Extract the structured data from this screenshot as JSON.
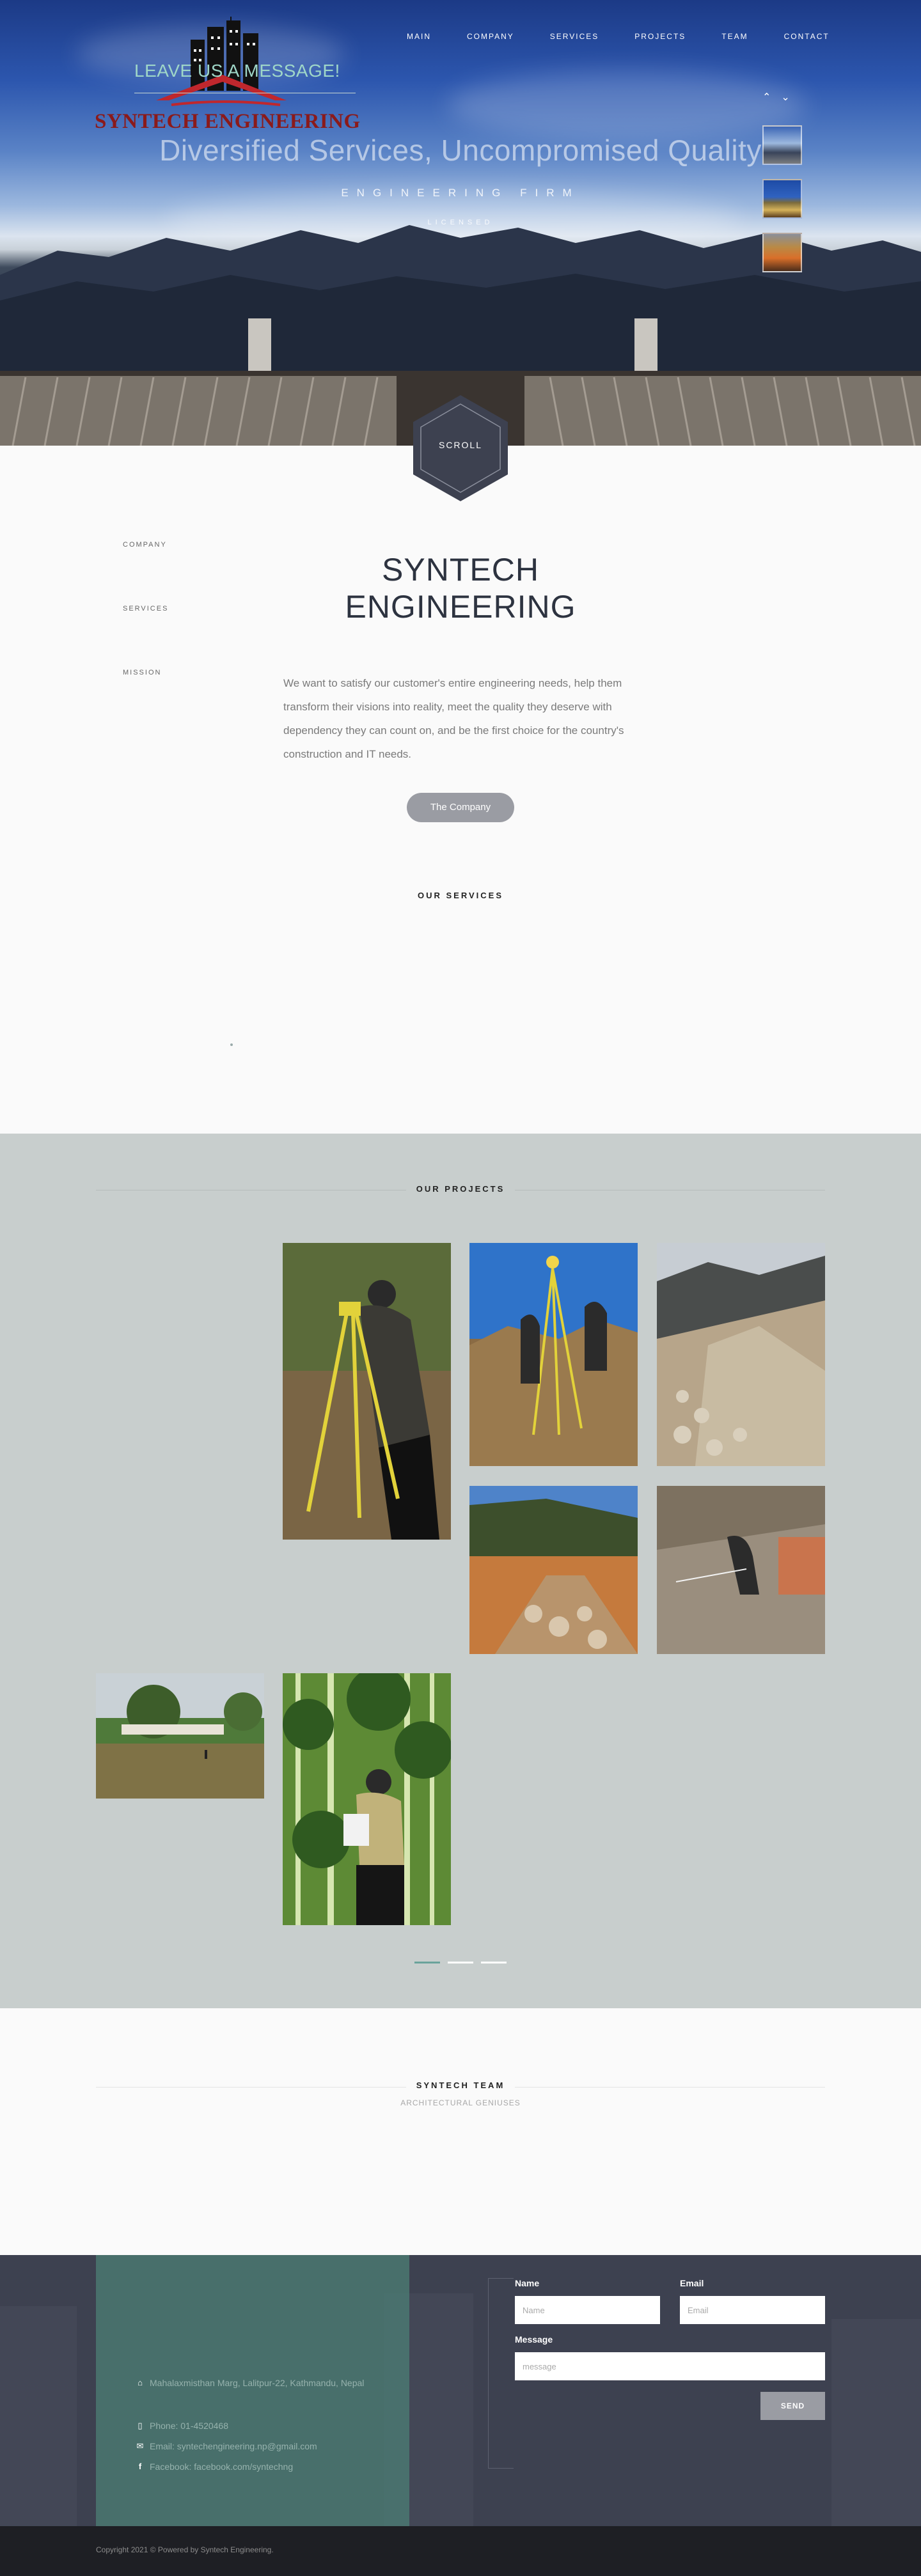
{
  "brand": {
    "name": "SYNTECH ENGINEERING"
  },
  "nav": {
    "items": [
      "MAIN",
      "COMPANY",
      "SERVICES",
      "PROJECTS",
      "TEAM",
      "CONTACT"
    ]
  },
  "hero": {
    "title": "Diversified Services, Uncompromised Quality",
    "subtitle": "ENGINEERING FIRM",
    "tagline": "LICENSED",
    "scroll_label": "SCROLL",
    "arrow_up": "⌃",
    "arrow_down": "⌄"
  },
  "about": {
    "side_links": [
      "COMPANY",
      "SERVICES",
      "MISSION"
    ],
    "title_line1": "SYNTECH",
    "title_line2": "ENGINEERING",
    "text": "We want to satisfy our customer's entire engineering needs, help them transform their visions into reality, meet the quality they deserve with dependency they can count on, and be the first choice for the country's construction and IT needs.",
    "button_label": "The Company"
  },
  "services": {
    "heading": "OUR SERVICES"
  },
  "projects": {
    "heading": "OUR PROJECTS"
  },
  "team": {
    "heading": "SYNTECH TEAM",
    "subheading": "ARCHITECTURAL GENIUSES"
  },
  "contact": {
    "heading": "LEAVE US A MESSAGE!",
    "address": "Mahalaxmisthan Marg, Lalitpur-22, Kathmandu, Nepal",
    "phone": "Phone: 01-4520468",
    "email": "Email: syntechengineering.np@gmail.com",
    "facebook": "Facebook: facebook.com/syntechng",
    "form": {
      "name_label": "Name",
      "name_placeholder": "Name",
      "email_label": "Email",
      "email_placeholder": "Email",
      "message_label": "Message",
      "message_placeholder": "message",
      "send_label": "SEND"
    }
  },
  "footer": {
    "copyright": "Copyright 2021 © Powered by Syntech Engineering."
  },
  "colors": {
    "accent_green": "#4c8176",
    "footer_bg": "#3d4150",
    "projects_bg": "#c8cecd",
    "logo_red": "#8b1a1a"
  }
}
